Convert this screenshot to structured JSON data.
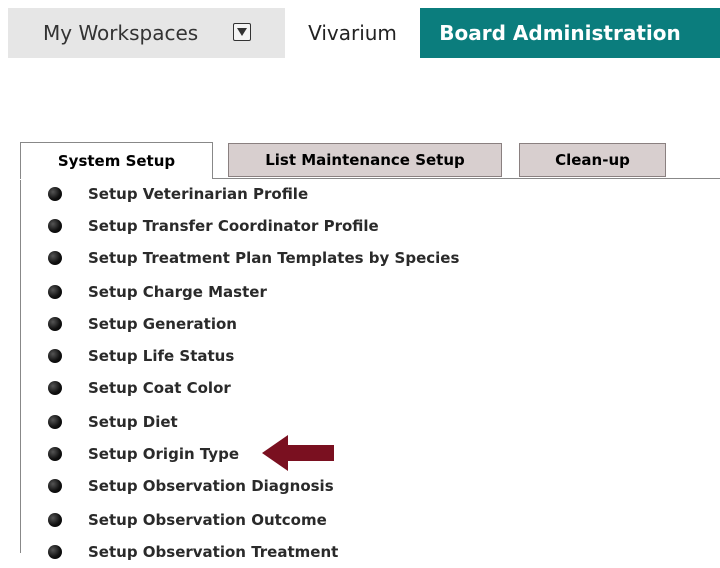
{
  "nav": {
    "workspaces_label": "My Workspaces",
    "vivarium_label": "Vivarium",
    "board_admin_label": "Board Administration",
    "board_admin_color": "#0b7d7d"
  },
  "tabs": [
    {
      "label": "System Setup",
      "active": true
    },
    {
      "label": "List Maintenance Setup",
      "active": false
    },
    {
      "label": "Clean-up",
      "active": false
    }
  ],
  "setup_items": [
    "Setup Veterinarian Profile",
    "Setup Transfer Coordinator Profile",
    "Setup Treatment Plan Templates by Species",
    "Setup Charge Master",
    "Setup Generation",
    "Setup Life Status",
    "Setup Coat Color",
    "Setup Diet",
    "Setup Origin Type",
    "Setup Observation Diagnosis",
    "Setup Observation Outcome",
    "Setup Observation Treatment"
  ],
  "annotation": {
    "arrow_icon": "left-arrow-icon",
    "arrow_color": "#7a1020",
    "points_to": "Setup Origin Type"
  }
}
